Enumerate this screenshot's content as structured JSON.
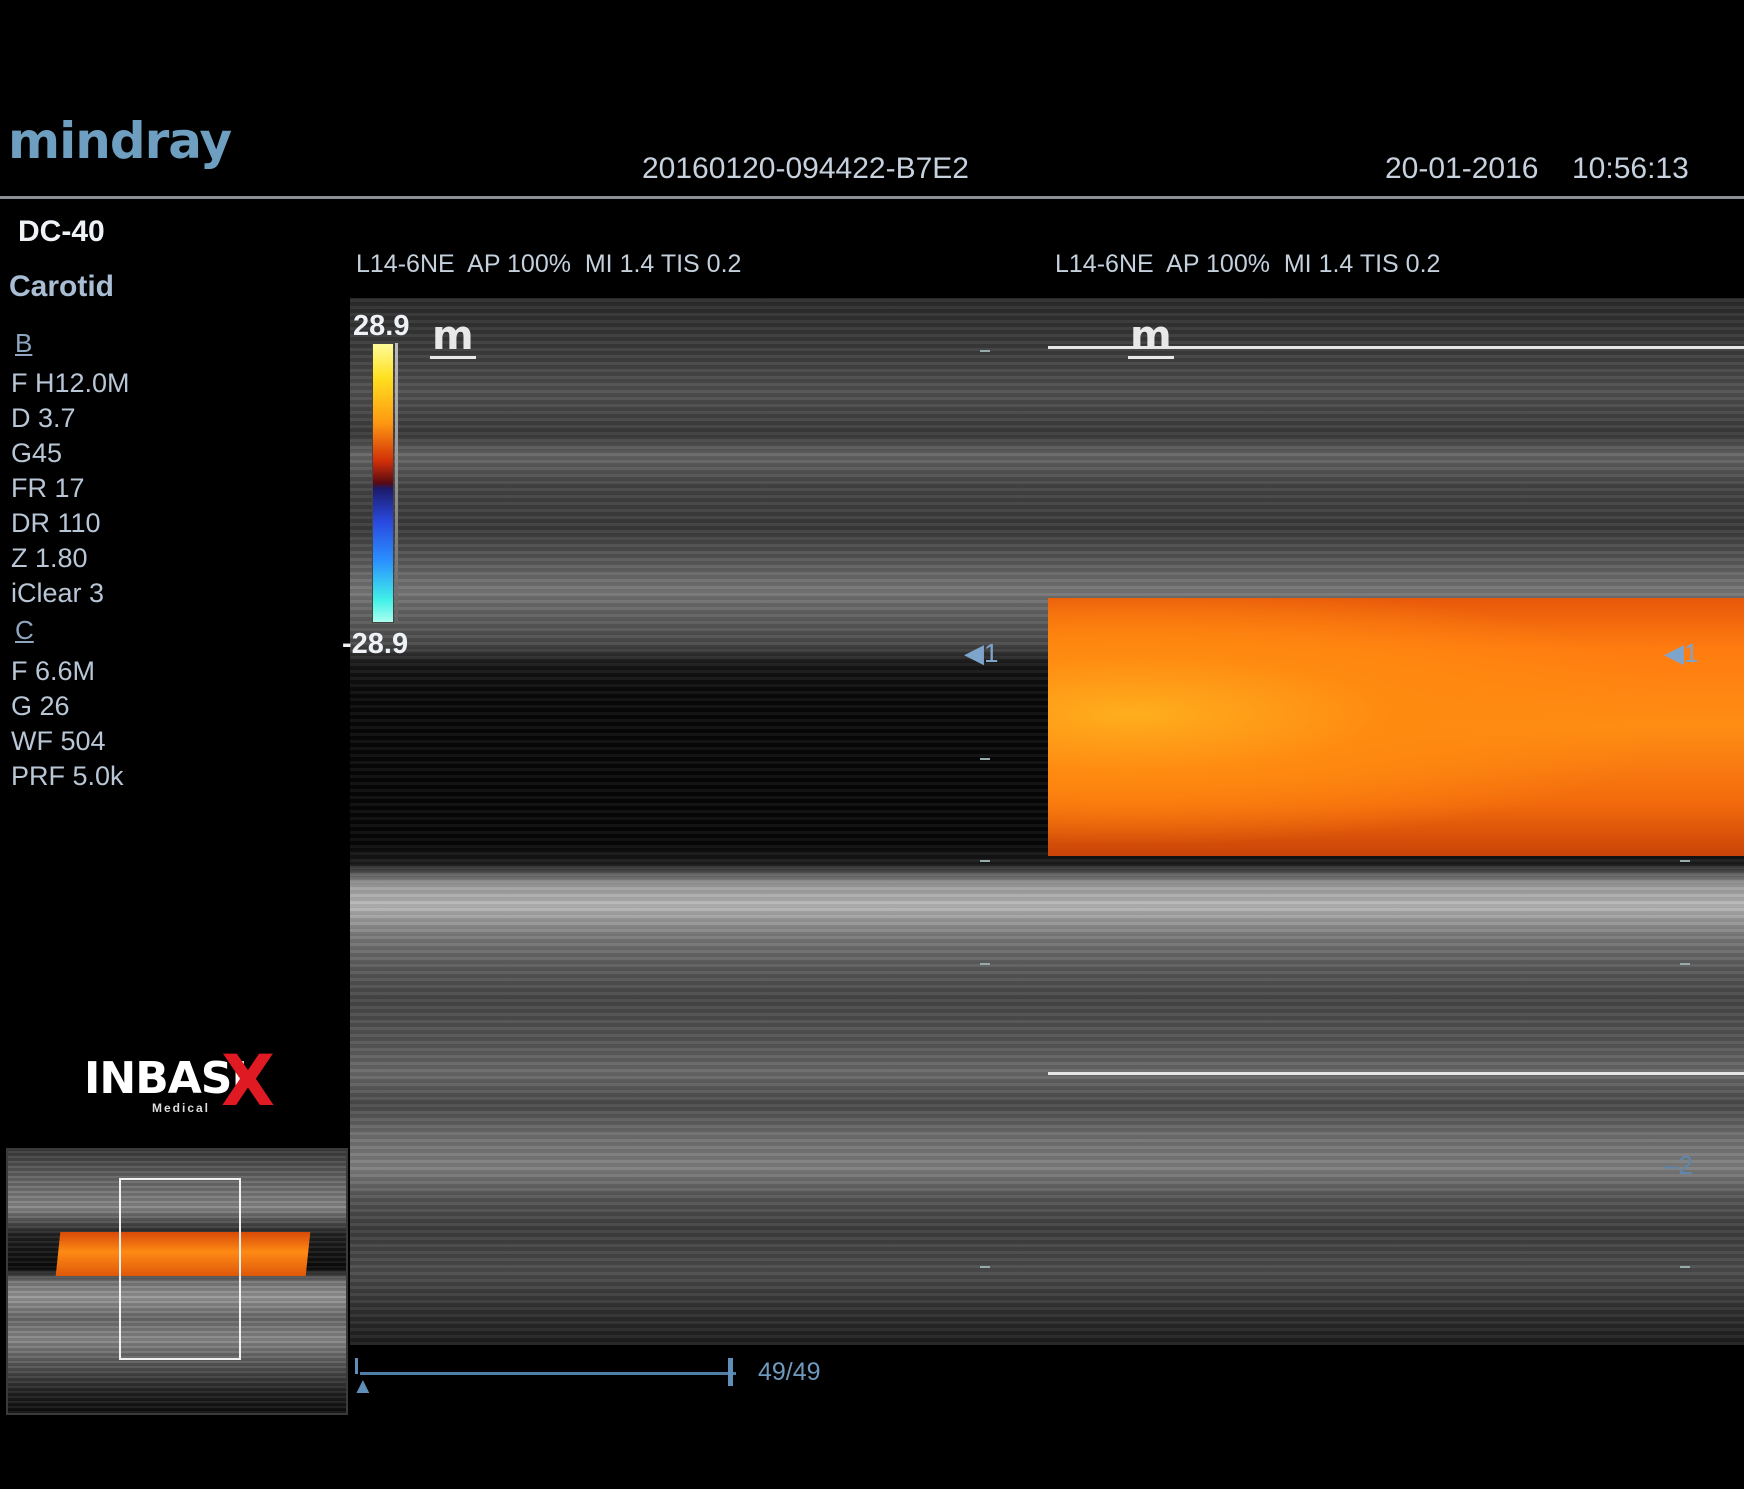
{
  "header": {
    "brand_logo": "mindray",
    "study_id": "20160120-094422-B7E2",
    "date": "20-01-2016",
    "time": "10:56:13"
  },
  "sidebar": {
    "model": "DC-40",
    "preset": "Carotid",
    "b_mode": {
      "label": "B",
      "params": [
        "F H12.0M",
        "D 3.7",
        "G45",
        "FR 17",
        "DR 110",
        "Z 1.80",
        "iClear 3"
      ]
    },
    "c_mode": {
      "label": "C",
      "params": [
        "F 6.6M",
        "G 26",
        "WF 504",
        "PRF 5.0k"
      ]
    },
    "watermark": {
      "text": "INBASI",
      "sub": "Medical",
      "x_mark": "X"
    }
  },
  "left_image": {
    "probe_info": "L14-6NE  AP 100%  MI 1.4 TIS 0.2",
    "mode_icon": "m",
    "focus_label": "1"
  },
  "right_image": {
    "probe_info": "L14-6NE  AP 100%  MI 1.4 TIS 0.2",
    "mode_icon": "m",
    "focus_label_1": "1",
    "focus_label_2": "2"
  },
  "color_scale": {
    "max": "28.9",
    "min": "-28.9"
  },
  "cine": {
    "frame": "49/49",
    "position_fraction": 1.0
  },
  "colors": {
    "accent": "#6e9fc0",
    "flow": "#ff8a14",
    "brand_red": "#e01a22"
  }
}
